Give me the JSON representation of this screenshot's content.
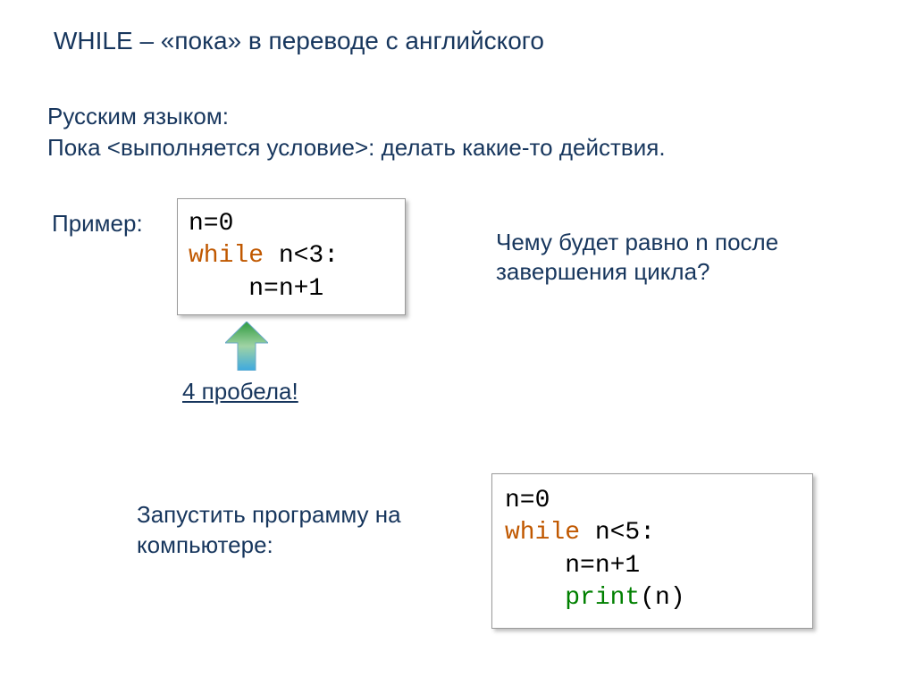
{
  "heading": "WHILE – «пока» в переводе с английского",
  "sub_line1": "Русским языком:",
  "sub_line2": "Пока <выполняется условие>: делать какие-то действия.",
  "example_label": "Пример:",
  "code1": {
    "l1": "n=0",
    "l2_kw": "while",
    "l2_rest": " n<3:",
    "l3": "    n=n+1"
  },
  "question_text": "Чему будет равно n после завершения цикла?",
  "spaces_note": "4 пробела!",
  "run_label": "Запустить программу на компьютере:",
  "code2": {
    "l1": "n=0",
    "l2_kw": "while",
    "l2_rest": " n<5:",
    "l3": "    n=n+1",
    "l4_indent": "    ",
    "l4_pr": "print",
    "l4_rest": "(n)"
  }
}
